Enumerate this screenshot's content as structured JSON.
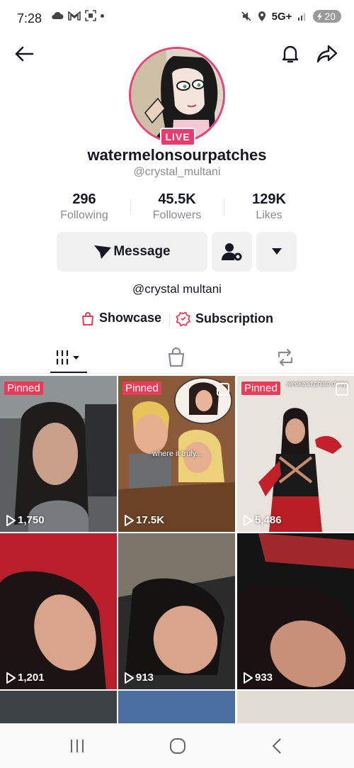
{
  "status_bar": {
    "time": "7:28",
    "network": "5G+",
    "battery": "20"
  },
  "profile": {
    "live_label": "LIVE",
    "display_name": "watermelonsourpatches",
    "username": "@crystal_multani",
    "bio": "@crystal multani"
  },
  "stats": [
    {
      "value": "296",
      "label": "Following"
    },
    {
      "value": "45.5K",
      "label": "Followers"
    },
    {
      "value": "129K",
      "label": "Likes"
    }
  ],
  "actions": {
    "message_label": "Message"
  },
  "links": {
    "showcase": "Showcase",
    "subscription": "Subscription"
  },
  "videos": [
    {
      "pinned": "Pinned",
      "views": "1,750"
    },
    {
      "pinned": "Pinned",
      "views": "17.5K",
      "caption": "where it truly..."
    },
    {
      "pinned": "Pinned",
      "views": "5,486",
      "caption": "weekend photo dump"
    },
    {
      "views": "1,201"
    },
    {
      "views": "913"
    },
    {
      "views": "933"
    }
  ],
  "colors": {
    "accent": "#ea3b58",
    "live": "#ea3b6f",
    "ring": "#e6457a",
    "muted_text": "#8a8b91"
  }
}
